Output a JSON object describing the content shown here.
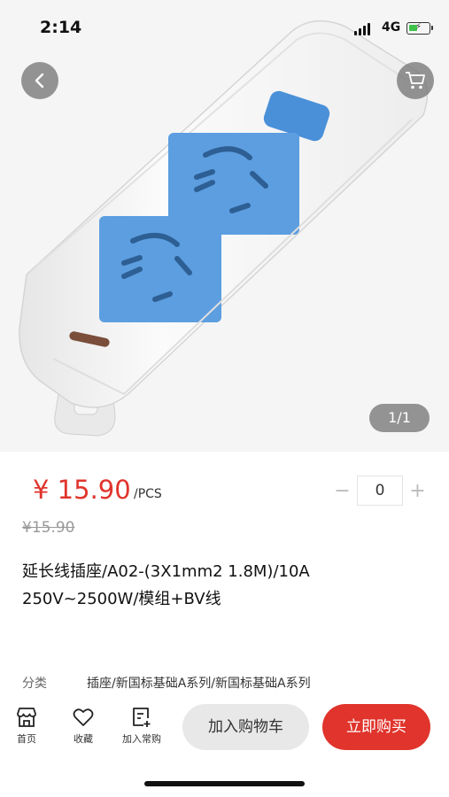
{
  "status": {
    "time": "2:14",
    "network": "4G"
  },
  "gallery": {
    "pager": "1/1"
  },
  "product": {
    "price": "¥ 15.90",
    "unit": "/PCS",
    "original_price": "¥15.90",
    "quantity": "0",
    "minus": "−",
    "plus": "+",
    "title": "延长线插座/A02-(3X1mm2 1.8M)/10A 250V~2500W/模组+BV线",
    "category_label": "分类",
    "category_value": "插座/新国标基础A系列/新国标基础A系列"
  },
  "bottom_bar": {
    "home": "首页",
    "favorite": "收藏",
    "add_frequent": "加入常购",
    "add_to_cart": "加入购物车",
    "buy_now": "立即购买"
  },
  "colors": {
    "accent": "#e0342c",
    "socket_blue": "#4a90d9"
  }
}
